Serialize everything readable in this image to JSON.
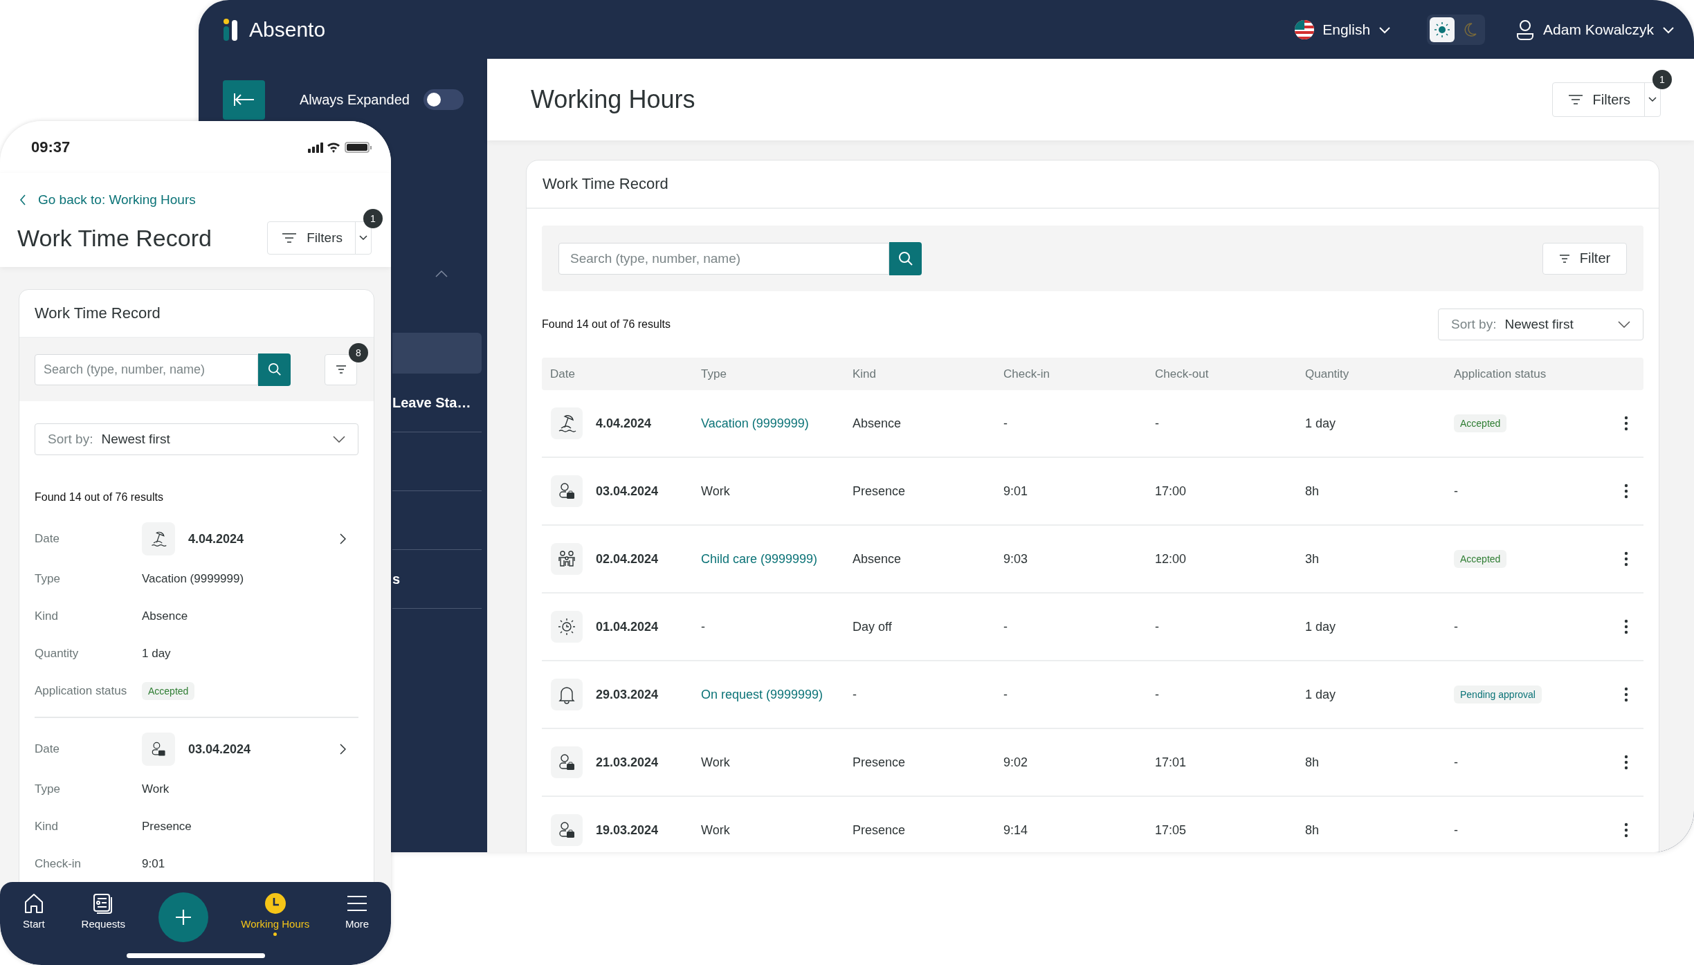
{
  "app": {
    "logo_text": "Absento",
    "language": "English",
    "theme": {
      "light_selected": true
    },
    "user": "Adam Kowalczyk"
  },
  "sidebar": {
    "toggle": {
      "label": "Always Expanded",
      "on": false
    },
    "items": [
      {
        "selected": true
      },
      {
        "label": "Leave Sta…",
        "selected": false
      },
      {
        "selected": false
      },
      {
        "selected": false
      },
      {
        "label": "s",
        "selected": false
      }
    ]
  },
  "page": {
    "title": "Working Hours",
    "filters": {
      "label": "Filters",
      "badge": "1"
    },
    "card": {
      "title": "Work Time Record",
      "search": {
        "placeholder": "Search (type, number, name)"
      },
      "filter_button": "Filter",
      "found": "Found 14 out of 76 results",
      "sort": {
        "label": "Sort by:",
        "value": "Newest first"
      },
      "table": {
        "columns": [
          "Date",
          "Type",
          "Kind",
          "Check-in",
          "Check-out",
          "Quantity",
          "Application status"
        ],
        "rows": [
          {
            "kind": "vacation",
            "date": "4.04.2024",
            "type": "Vacation (9999999)",
            "type_link": true,
            "entry_kind": "Absence",
            "check_in": "-",
            "check_out": "-",
            "quantity": "1 day",
            "status": {
              "text": "Accepted",
              "kind": "accepted"
            }
          },
          {
            "kind": "work",
            "date": "03.04.2024",
            "type": "Work",
            "type_link": false,
            "entry_kind": "Presence",
            "check_in": "9:01",
            "check_out": "17:00",
            "quantity": "8h",
            "status": {
              "text": "-",
              "kind": "none"
            }
          },
          {
            "kind": "childcare",
            "date": "02.04.2024",
            "type": "Child care (9999999)",
            "type_link": true,
            "entry_kind": "Absence",
            "check_in": "9:03",
            "check_out": "12:00",
            "quantity": "3h",
            "status": {
              "text": "Accepted",
              "kind": "accepted"
            }
          },
          {
            "kind": "dayoff",
            "date": "01.04.2024",
            "type": "-",
            "type_link": false,
            "entry_kind": "Day off",
            "check_in": "-",
            "check_out": "-",
            "quantity": "1 day",
            "status": {
              "text": "-",
              "kind": "none"
            }
          },
          {
            "kind": "request",
            "date": "29.03.2024",
            "type": "On request (9999999)",
            "type_link": true,
            "entry_kind": "-",
            "check_in": "-",
            "check_out": "-",
            "quantity": "1 day",
            "status": {
              "text": "Pending approval",
              "kind": "pending"
            }
          },
          {
            "kind": "work",
            "date": "21.03.2024",
            "type": "Work",
            "type_link": false,
            "entry_kind": "Presence",
            "check_in": "9:02",
            "check_out": "17:01",
            "quantity": "8h",
            "status": {
              "text": "-",
              "kind": "none"
            }
          },
          {
            "kind": "work",
            "date": "19.03.2024",
            "type": "Work",
            "type_link": false,
            "entry_kind": "Presence",
            "check_in": "9:14",
            "check_out": "17:05",
            "quantity": "8h",
            "status": {
              "text": "-",
              "kind": "none"
            }
          }
        ]
      }
    }
  },
  "phone": {
    "time": "09:37",
    "back_link": "Go back to: Working Hours",
    "title": "Work Time Record",
    "filters": {
      "label": "Filters",
      "badge": "1"
    },
    "card": {
      "title": "Work Time Record",
      "search": {
        "placeholder": "Search (type, number, name)"
      },
      "filter_badge": "8",
      "sort": {
        "label": "Sort by:",
        "value": "Newest first"
      },
      "found": "Found 14 out of 76 results",
      "records": [
        {
          "kind": "vacation",
          "fields": [
            {
              "label": "Date",
              "value": "4.04.2024",
              "kind": "date"
            },
            {
              "label": "Type",
              "value": "Vacation (9999999)",
              "kind": "link"
            },
            {
              "label": "Kind",
              "value": "Absence",
              "kind": "text"
            },
            {
              "label": "Quantity",
              "value": "1 day",
              "kind": "text"
            },
            {
              "label": "Application status",
              "value": "Accepted",
              "kind": "status"
            }
          ]
        },
        {
          "kind": "work",
          "fields": [
            {
              "label": "Date",
              "value": "03.04.2024",
              "kind": "date"
            },
            {
              "label": "Type",
              "value": "Work",
              "kind": "text"
            },
            {
              "label": "Kind",
              "value": "Presence",
              "kind": "text"
            },
            {
              "label": "Check-in",
              "value": "9:01",
              "kind": "text"
            }
          ]
        }
      ]
    },
    "nav": [
      {
        "kind": "home",
        "label": "Start",
        "selected": false
      },
      {
        "kind": "requests",
        "label": "Requests",
        "selected": false
      },
      {
        "kind": "fab"
      },
      {
        "kind": "clock",
        "label": "Working Hours",
        "selected": true
      },
      {
        "kind": "menu",
        "label": "More",
        "selected": false
      }
    ]
  }
}
